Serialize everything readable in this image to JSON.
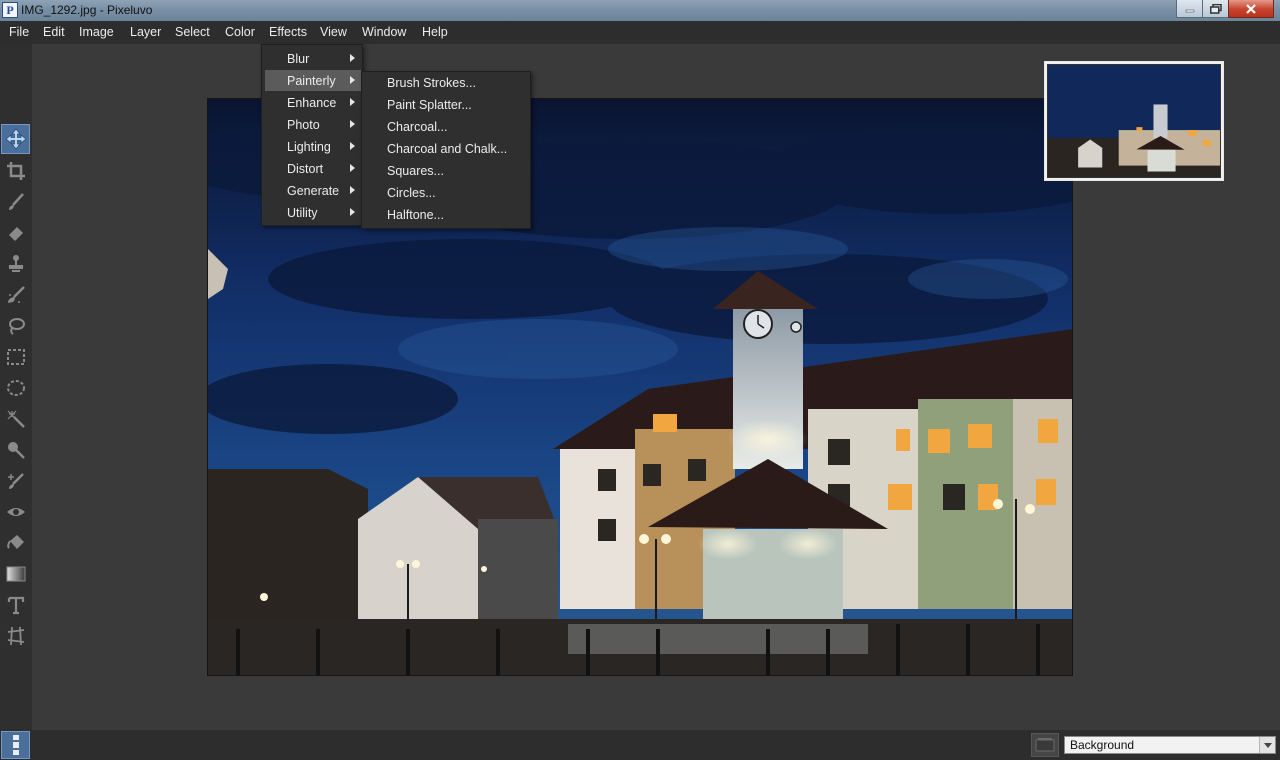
{
  "window": {
    "title": "IMG_1292.jpg - Pixeluvo",
    "app_icon_letter": "P"
  },
  "menubar": {
    "items": [
      "File",
      "Edit",
      "Image",
      "Layer",
      "Select",
      "Color",
      "Effects",
      "View",
      "Window",
      "Help"
    ]
  },
  "effects_menu": {
    "items": [
      "Blur",
      "Painterly",
      "Enhance",
      "Photo",
      "Lighting",
      "Distort",
      "Generate",
      "Utility"
    ],
    "highlighted": "Painterly"
  },
  "painterly_submenu": {
    "items": [
      "Brush Strokes...",
      "Paint Splatter...",
      "Charcoal...",
      "Charcoal and Chalk...",
      "Squares...",
      "Circles...",
      "Halftone..."
    ]
  },
  "toolbar": {
    "tools": [
      "move-icon",
      "crop-icon",
      "brush-icon",
      "eraser-icon",
      "clone-stamp-icon",
      "smudge-brush-icon",
      "lasso-icon",
      "rect-select-icon",
      "ellipse-select-icon",
      "magic-wand-icon",
      "dodge-burn-icon",
      "healing-icon",
      "red-eye-icon",
      "paint-bucket-icon",
      "gradient-icon",
      "text-icon",
      "perspective-icon"
    ],
    "active_tool": "move-icon"
  },
  "layers": {
    "selected_layer": "Background"
  },
  "colors": {
    "accent": "#4a6f9a",
    "menu_bg": "#2f2f2f",
    "workspace_bg": "#3a3a3a"
  }
}
